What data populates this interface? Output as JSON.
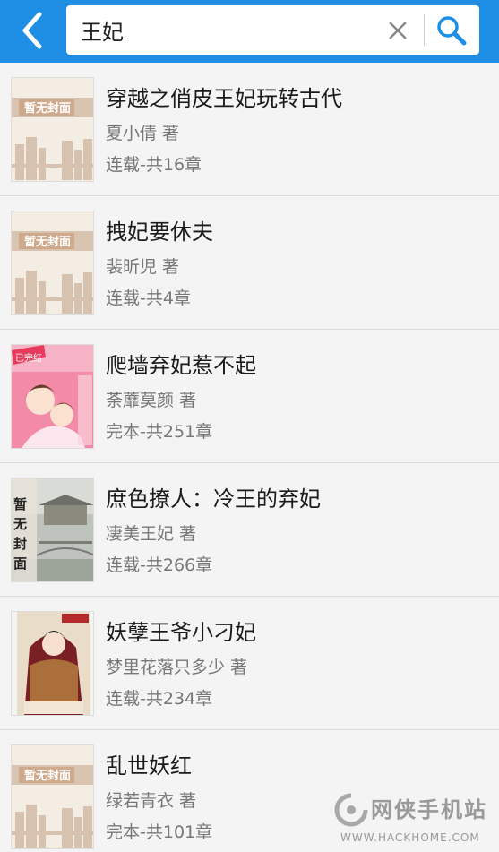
{
  "header": {
    "search_value": "王妃",
    "back_icon": "back-arrow-icon",
    "clear_icon": "close-icon",
    "search_icon": "search-icon",
    "bar_color": "#1f8fe6"
  },
  "books": [
    {
      "title": "穿越之俏皮王妃玩转古代",
      "author": "夏小倩 著",
      "status": "连载-共16章",
      "cover": "placeholder",
      "cover_text": "暂无封面"
    },
    {
      "title": "拽妃要休夫",
      "author": "裴昕児 著",
      "status": "连载-共4章",
      "cover": "placeholder",
      "cover_text": "暂无封面"
    },
    {
      "title": "爬墙弃妃惹不起",
      "author": "荼蘼莫颜 著",
      "status": "完本-共251章",
      "cover": "pink",
      "cover_text": "已完结"
    },
    {
      "title": "庶色撩人：冷王的弃妃",
      "author": "凄美王妃 著",
      "status": "连载-共266章",
      "cover": "scenery",
      "cover_text": "暂无封面"
    },
    {
      "title": "妖孽王爷小刁妃",
      "author": "梦里花落只多少 著",
      "status": "连载-共234章",
      "cover": "portrait",
      "cover_text": "妖孽王爷小刁妃"
    },
    {
      "title": "乱世妖红",
      "author": "绿若青衣 著",
      "status": "完本-共101章",
      "cover": "placeholder",
      "cover_text": "暂无封面"
    }
  ],
  "watermark": {
    "text": "网侠手机站",
    "url": "WWW.HACKHOME.COM"
  }
}
